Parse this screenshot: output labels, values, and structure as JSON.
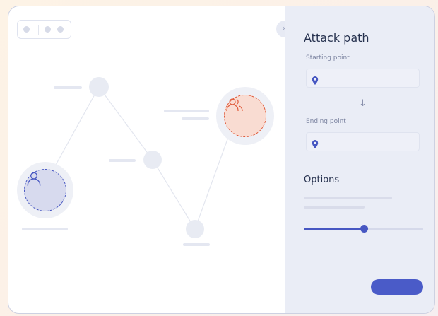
{
  "window": {
    "tab_dots": 3
  },
  "graph": {
    "nodes": [
      "user-node",
      "waypoint-1",
      "waypoint-2",
      "waypoint-3",
      "group-node"
    ],
    "source_accent": "#4757c2",
    "target_accent": "#e05a3a",
    "icons": [
      "user-icon",
      "users-icon"
    ]
  },
  "panel": {
    "collapse_icon": "double-chevron-right-icon",
    "title": "Attack path",
    "start_label": "Starting point",
    "start_value": "",
    "end_label": "Ending point",
    "end_value": "",
    "location_icon": "map-pin-icon",
    "arrow_glyph": "↓",
    "options_title": "Options",
    "slider_value": 0.5,
    "submit_label": ""
  },
  "colors": {
    "accent": "#4a5bc8",
    "panel_bg": "#eaedf6",
    "text_primary": "#27324f"
  }
}
